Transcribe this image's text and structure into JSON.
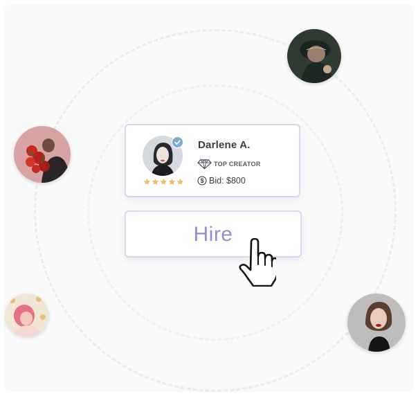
{
  "creator": {
    "name": "Darlene A.",
    "title": "TOP CREATOR",
    "bid": "Bid: $800",
    "rating": 5,
    "verified": true
  },
  "hire_button": {
    "label": "Hire"
  },
  "icons": {
    "title_icon": "diamond-icon",
    "bid_icon": "dollar-coin-icon",
    "verified_icon": "verified-check-icon",
    "rating_icon": "star-icon",
    "cursor": "hand-pointer-icon"
  },
  "colors": {
    "accent": "#9b8bcd",
    "card_border": "#dad6ea",
    "star": "#f0b96a",
    "verified": "#7aaed0"
  }
}
